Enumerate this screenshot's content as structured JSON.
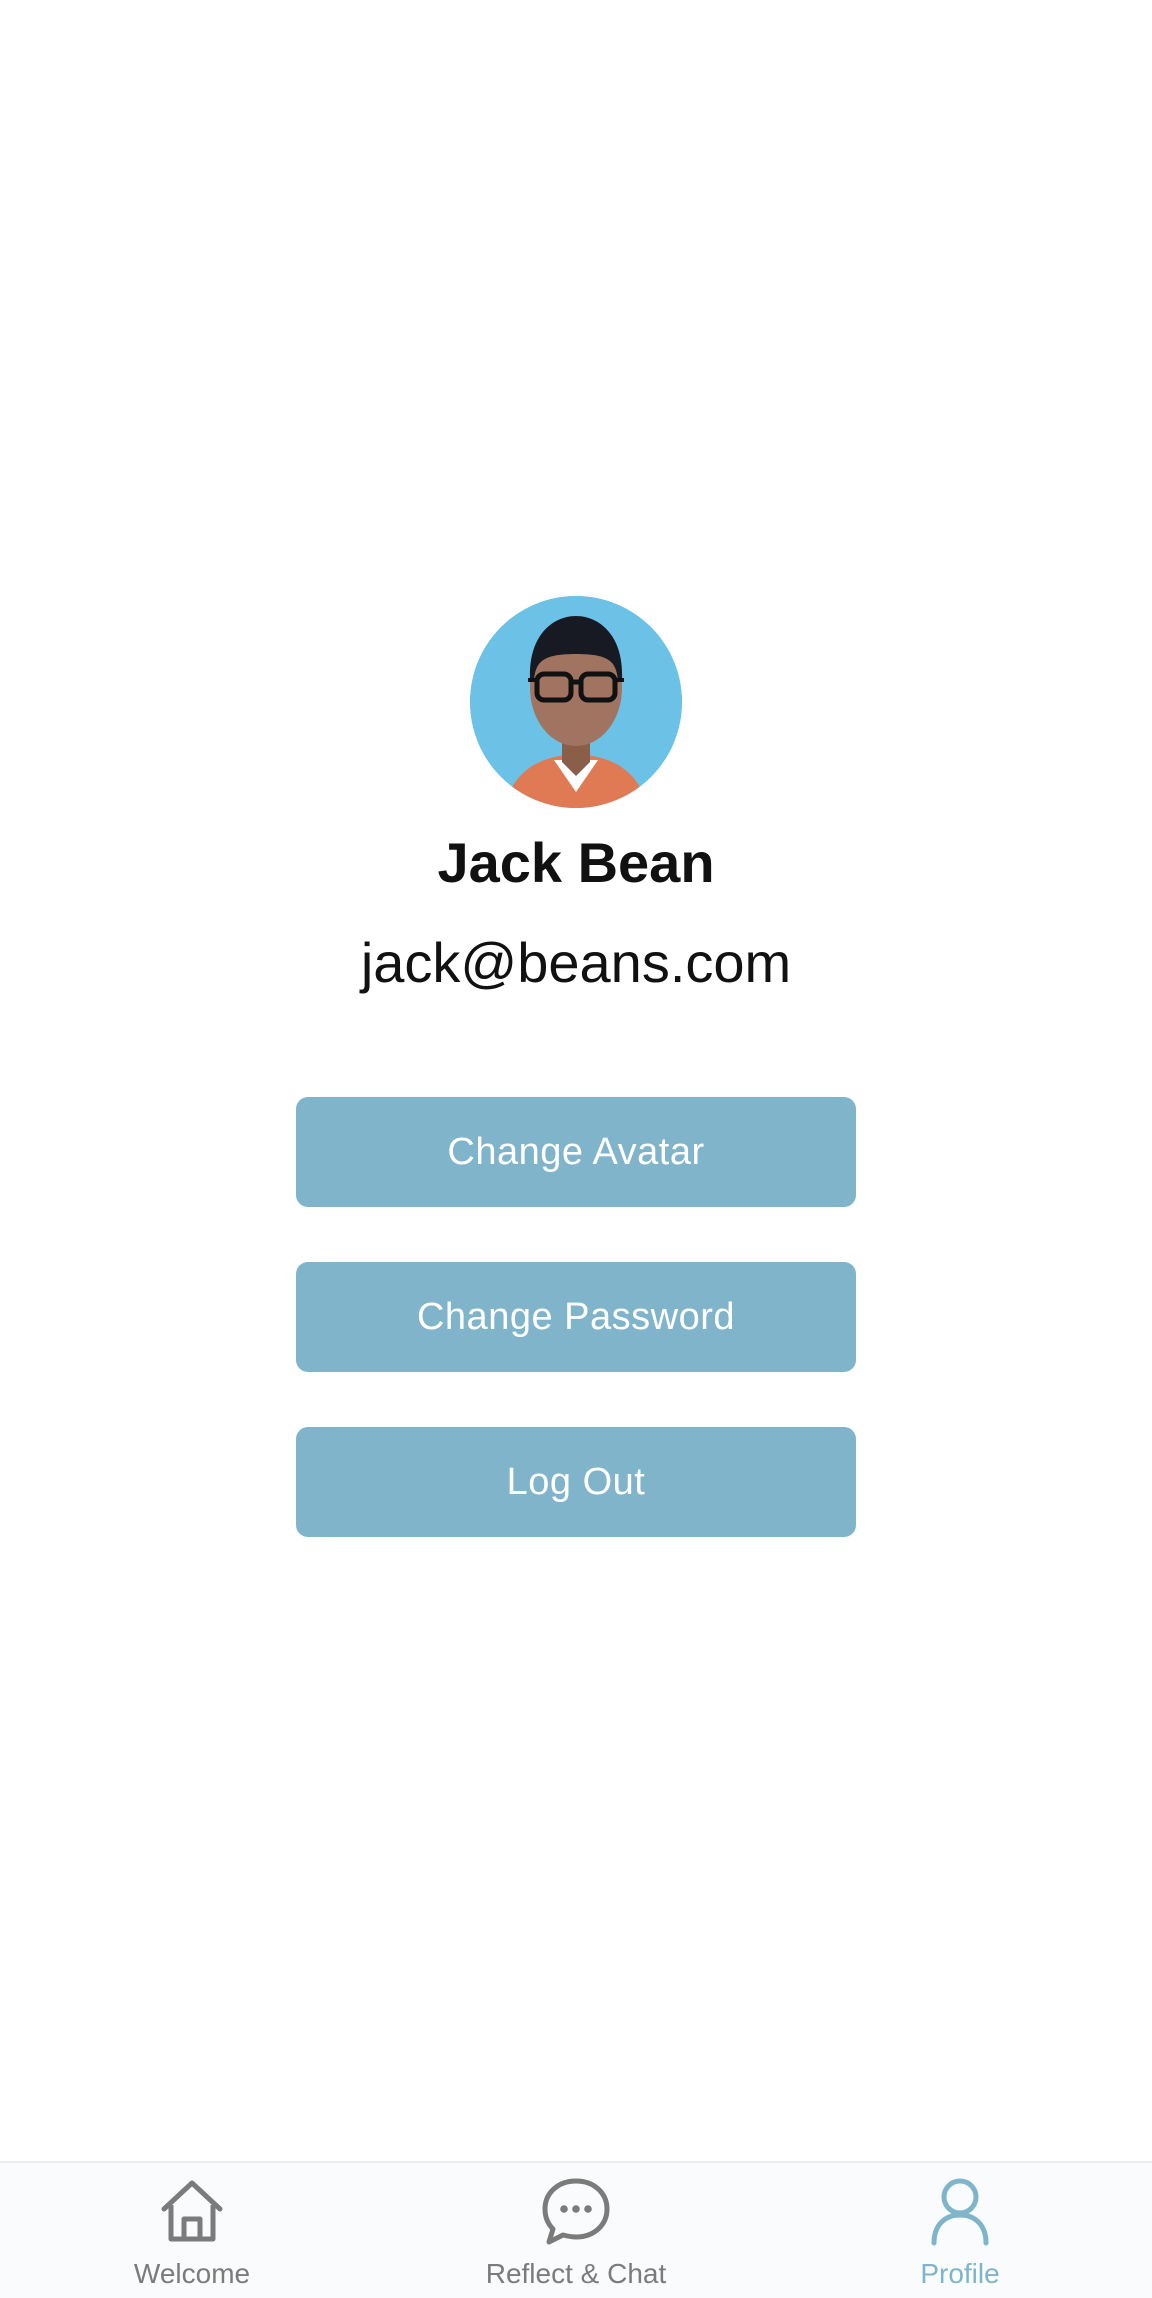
{
  "profile": {
    "name": "Jack Bean",
    "email": "jack@beans.com"
  },
  "actions": {
    "change_avatar_label": "Change Avatar",
    "change_password_label": "Change Password",
    "logout_label": "Log Out"
  },
  "tabbar": {
    "tabs": [
      {
        "label": "Welcome",
        "icon": "home-icon",
        "active": false
      },
      {
        "label": "Reflect & Chat",
        "icon": "chat-bubble-icon",
        "active": false
      },
      {
        "label": "Profile",
        "icon": "person-icon",
        "active": true
      }
    ]
  },
  "colors": {
    "button_bg": "#80b4ca",
    "button_text": "#ffffff",
    "active_tab": "#7fb5cb",
    "inactive_tab": "#7b7b7b",
    "avatar_bg": "#6cc2e6"
  }
}
